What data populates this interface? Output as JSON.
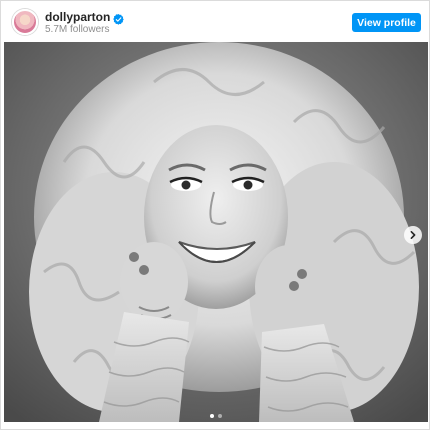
{
  "post": {
    "username": "dollyparton",
    "followers": "5.7M followers",
    "verified": true,
    "view_profile_label": "View profile",
    "carousel": {
      "total": 2,
      "active_index": 0
    }
  },
  "colors": {
    "accent": "#0095f6",
    "text_primary": "#262626",
    "text_secondary": "#8e8e8e"
  },
  "icons": {
    "verified": "verified-badge-icon",
    "next": "chevron-right-icon"
  }
}
